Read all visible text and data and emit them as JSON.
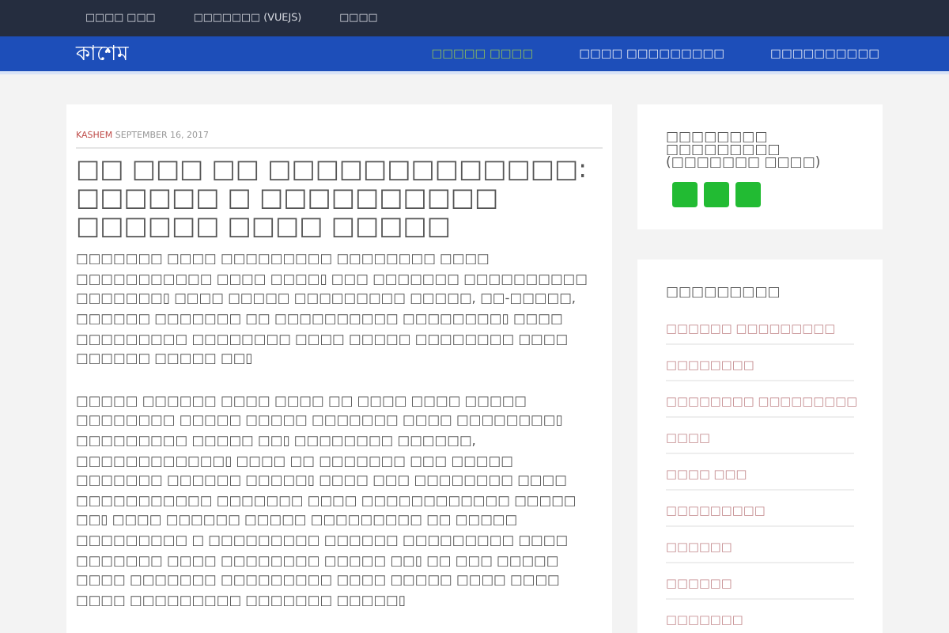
{
  "top_menu": [
    "□□□□ □□□",
    "□□□□□□□ (VUEJS)",
    "□□□□"
  ],
  "header": {
    "brand": "কাশেম",
    "menu": [
      {
        "label": "□□□□□ □□□□",
        "selected": true
      },
      {
        "label": "□□□□ □□□□□□□□□",
        "selected": false
      },
      {
        "label": "□□□□□□□□□□",
        "selected": false
      }
    ]
  },
  "post": {
    "author": "KASHEM",
    "date": "SEPTEMBER 16, 2017",
    "title": "□□ □□□ □□ □□□□□□□□□□□□□: □□□□□□ □ □□□□□□□□□□ □□□□□□ □□□□ □□□□□",
    "paragraphs": [
      "□□□□□□□ □□□□ □□□□□□□□□ □□□□□□□□ □□□□ □□□□□□□□□□□ □□□□ □□□□▯ □□□ □□□□□□□ □□□□□□□□□□ □□□□□□□▯ □□□□ □□□□□ □□□□□□□□□ □□□□□, □□-□□□□□, □□□□□□ □□□□□□□ □□ □□□□□□□□□□ □□□□□□□□▯ □□□□ □□□□□□□□□ □□□□□□□□ □□□□ □□□□□ □□□□□□□□ □□□□ □□□□□□ □□□□□ □□▯",
      "□□□□□ □□□□□□ □□□□ □□□□ □□ □□□□ □□□□ □□□□□ □□□□□□□□ □□□□□ □□□□□ □□□□□□□ □□□□ □□□□□□□□▯ □□□□□□□□□ □□□□□ □□▯ □□□□□□□□ □□□□□□, □□□□□□□□□□□□▯ □□□□ □□ □□□□□□□ □□□ □□□□□ □□□□□□□ □□□□□□ □□□□□▯ □□□□ □□□ □□□□□□□□ □□□□ □□□□□□□□□□□ □□□□□□□ □□□□ □□□□□□□□□□□□ □□□□□ □□▯ □□□□ □□□□□□ □□□□□ □□□□□□□□□ □□ □□□□□ □□□□□□□□□ □ □□□□□□□□□ □□□□□□ □□□□□□□□□ □□□□ □□□□□□□ □□□□ □□□□□□□□ □□□□□ □□▯ □□ □□□ □□□□□ □□□□ □□□□□□□ □□□□□□□□□ □□□□ □□□□□ □□□□ □□□□ □□□□ □□□□□□□□□ □□□□□□□ □□□□□▯"
    ]
  },
  "widget_share": {
    "title": "□□□□□□□□ □□□□□□□□□ (□□□□□□□ □□□□)"
  },
  "widget_categories": {
    "title": "□□□□□□□□□",
    "items": [
      "□□□□□□ □□□□□□□□□",
      "□□□□□□□□",
      "□□□□□□□□ □□□□□□□□□",
      "□□□□",
      "□□□□ □□□",
      "□□□□□□□□□",
      "□□□□□□",
      "□□□□□□",
      "□□□□□□□"
    ]
  }
}
